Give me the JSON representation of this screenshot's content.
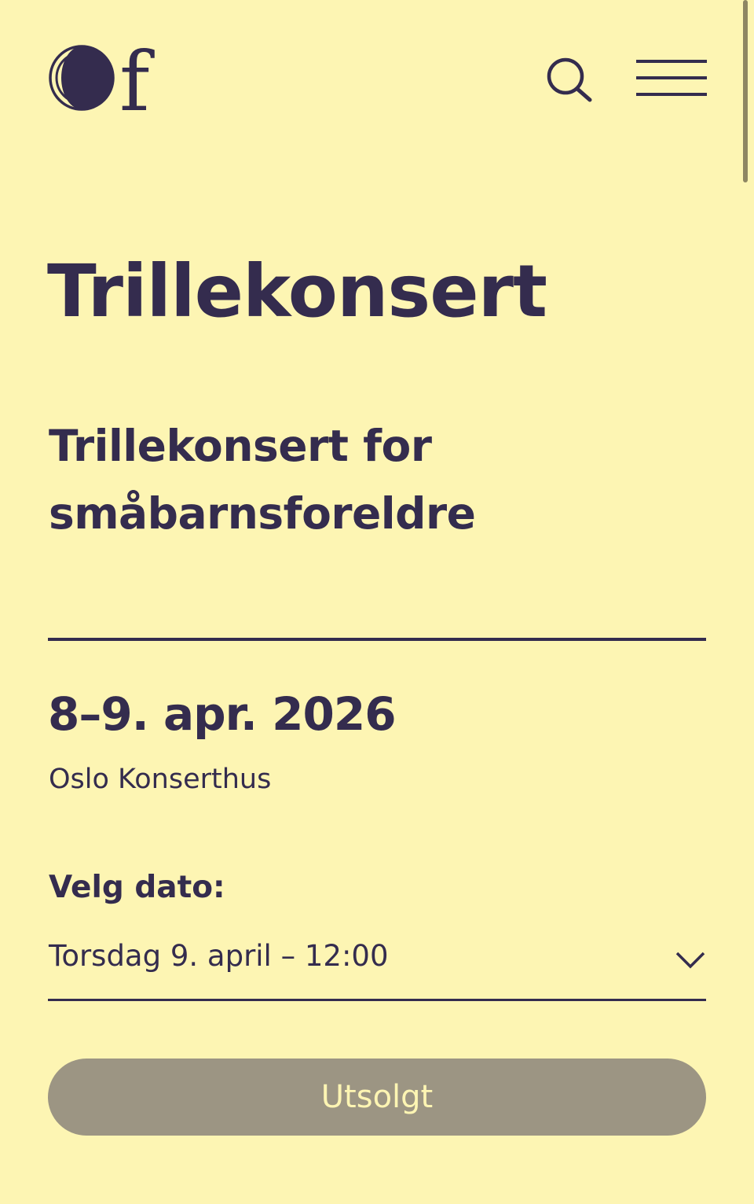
{
  "header": {
    "logo_icon": "oslo-filharmonien-logo-icon",
    "search_icon": "search-icon",
    "menu_icon": "hamburger-menu-icon"
  },
  "event": {
    "title": "Trillekonsert",
    "subtitle": "Trillekonsert for småbarnsforeldre",
    "date_range": "8–9. apr. 2026",
    "venue": "Oslo Konserthus"
  },
  "date_picker": {
    "label": "Velg dato:",
    "selected_value": "Torsdag 9. april – 12:00",
    "chevron_icon": "chevron-down-icon"
  },
  "ticket": {
    "button_label": "Utsolgt",
    "button_color": "#9c9583"
  },
  "theme": {
    "background": "#fdf5b3",
    "text": "#342c4e"
  }
}
